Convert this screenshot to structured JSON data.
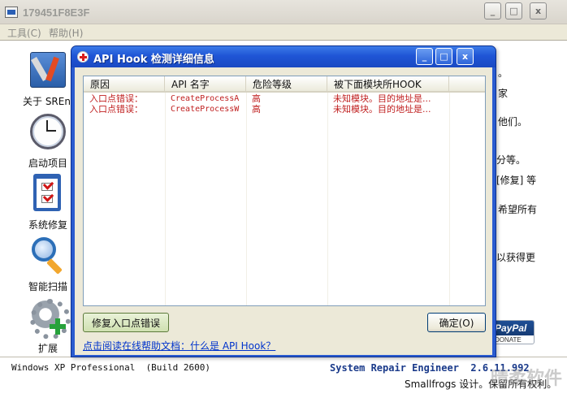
{
  "main_window": {
    "title": "179451F8E3F",
    "menu": [
      "工具(C)",
      "帮助(H)"
    ],
    "caption_buttons": [
      "_",
      "□",
      "x"
    ]
  },
  "sidebar": {
    "items": [
      {
        "label": "关于 SREng",
        "icon": "tools-icon"
      },
      {
        "label": "启动项目",
        "icon": "clock-icon"
      },
      {
        "label": "系统修复",
        "icon": "checklist-icon"
      },
      {
        "label": "智能扫描",
        "icon": "magnifier-icon"
      },
      {
        "label": "扩展",
        "icon": "gear-plus-icon"
      }
    ]
  },
  "background_fragments": [
    "。",
    "家",
    "他们。",
    "分等。",
    "[修复] 等",
    "希望所有",
    "以获得更"
  ],
  "paypal": {
    "top": "PayPal",
    "bottom": "DONATE"
  },
  "statusbar": {
    "os_info": "Windows XP Professional  (Build 2600)",
    "product": "System Repair Engineer  2.6.11.992",
    "copyright": "Smallfrogs 设计。保留所有权利。",
    "watermark": "晴柔软件"
  },
  "dialog": {
    "title": "API Hook 检测详细信息",
    "caption_buttons": [
      "_",
      "□",
      "x"
    ],
    "columns": [
      "原因",
      "API 名字",
      "危险等级",
      "被下面模块所HOOK"
    ],
    "rows": [
      [
        "入口点错误：",
        "CreateProcessA",
        "高",
        "未知模块。目的地址是..."
      ],
      [
        "入口点错误：",
        "CreateProcessW",
        "高",
        "未知模块。目的地址是..."
      ]
    ],
    "repair_button": "修复入口点错误",
    "ok_button": "确定(O)",
    "help_link": "点击阅读在线帮助文档：什么是 API Hook？"
  },
  "colors": {
    "dialog_title_blue": "#1f55d6",
    "row_text_red": "#c02020",
    "link_blue": "#0033cc",
    "product_blue": "#1a3a8a"
  }
}
